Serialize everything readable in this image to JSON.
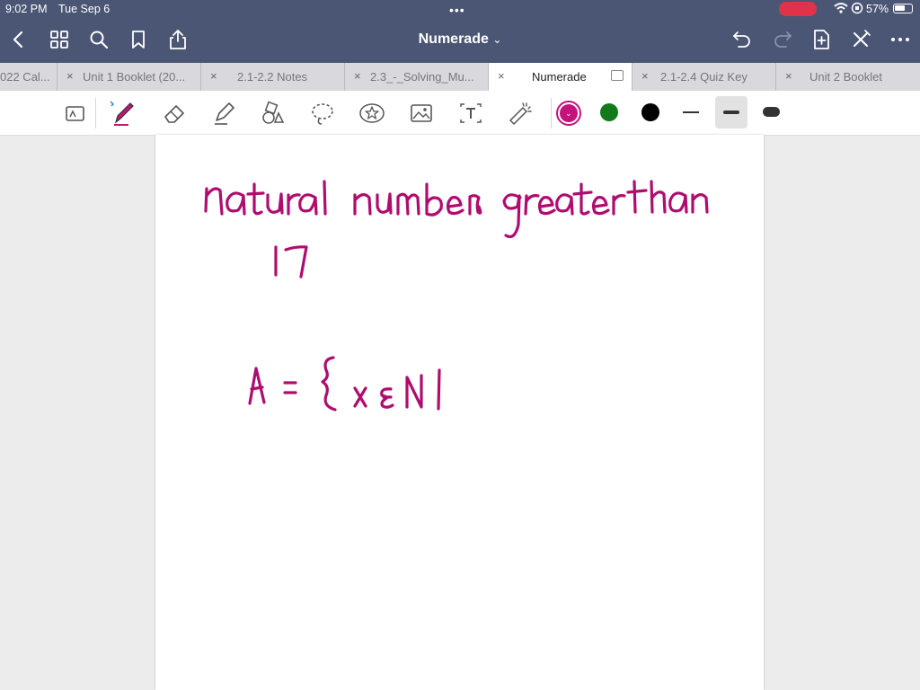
{
  "status": {
    "time": "9:02 PM",
    "date": "Tue Sep 6",
    "battery": "57%"
  },
  "header": {
    "title": "Numerade",
    "title_caret": "⌄"
  },
  "tabs": [
    {
      "label": "022 Cal...",
      "active": false
    },
    {
      "label": "Unit 1 Booklet (20...",
      "active": false
    },
    {
      "label": "2.1-2.2 Notes",
      "active": false
    },
    {
      "label": "2.3_-_Solving_Mu...",
      "active": false
    },
    {
      "label": "Numerade",
      "active": true
    },
    {
      "label": "2.1-2.4 Quiz Key",
      "active": false
    },
    {
      "label": "Unit 2 Booklet",
      "active": false
    }
  ],
  "tab_close_glyph": "×",
  "toolbar": {
    "colors": {
      "active": "#c4137a",
      "green": "#127a1b",
      "black": "#000000"
    },
    "selected_stroke": "medium"
  },
  "ink_color": "#b00c70",
  "note": {
    "line1": "natural numbers greater than",
    "line2": "17",
    "line3": "A = {x ε N|"
  }
}
